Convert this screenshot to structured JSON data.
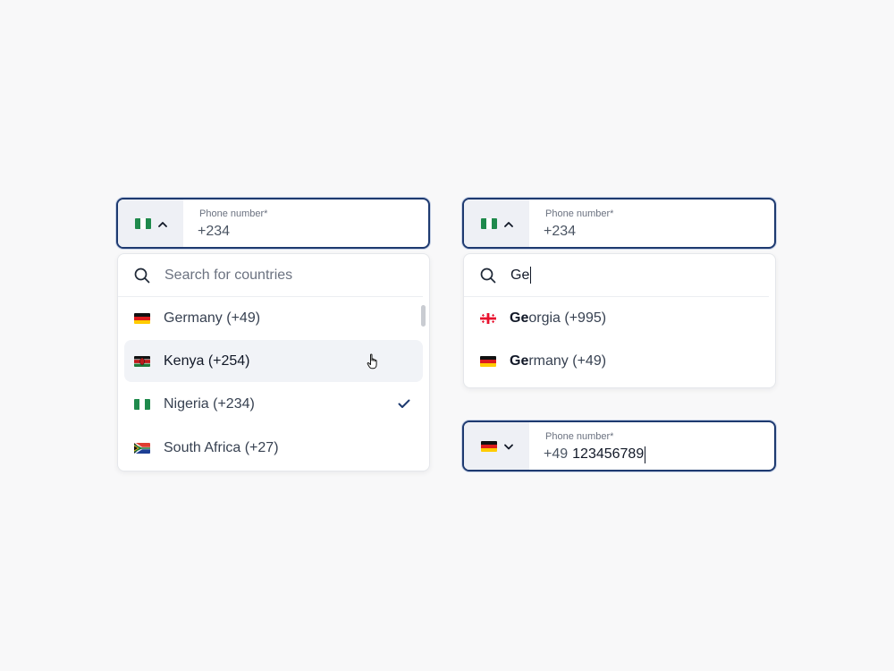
{
  "left_widget": {
    "field": {
      "label": "Phone number*",
      "value": "+234",
      "flag_icon": "nigeria-flag-icon",
      "chevron_icon": "chevron-up-icon"
    },
    "dropdown": {
      "search_placeholder": "Search for countries",
      "options": [
        {
          "label": "Germany (+49)",
          "flag": "germany-flag-icon",
          "state": "default"
        },
        {
          "label": "Kenya (+254)",
          "flag": "kenya-flag-icon",
          "state": "hover"
        },
        {
          "label": "Nigeria (+234)",
          "flag": "nigeria-flag-icon",
          "state": "selected"
        },
        {
          "label": "South Africa (+27)",
          "flag": "south-africa-flag-icon",
          "state": "default"
        }
      ]
    }
  },
  "right_widget": {
    "field": {
      "label": "Phone number*",
      "value": "+234",
      "flag_icon": "nigeria-flag-icon",
      "chevron_icon": "chevron-up-icon"
    },
    "dropdown": {
      "search_value": "Ge",
      "options": [
        {
          "match": "Ge",
          "rest": "orgia (+995)",
          "flag": "georgia-flag-icon"
        },
        {
          "match": "Ge",
          "rest": "rmany (+49)",
          "flag": "germany-flag-icon"
        }
      ]
    }
  },
  "filled_widget": {
    "field": {
      "label": "Phone number*",
      "prefix": "+49",
      "number": "123456789",
      "flag_icon": "germany-flag-icon",
      "chevron_icon": "chevron-down-icon"
    }
  },
  "colors": {
    "focus_border": "#1e3a70",
    "trigger_bg": "#eef0f5",
    "hover_bg": "#f1f3f7",
    "check": "#1e3a70"
  }
}
